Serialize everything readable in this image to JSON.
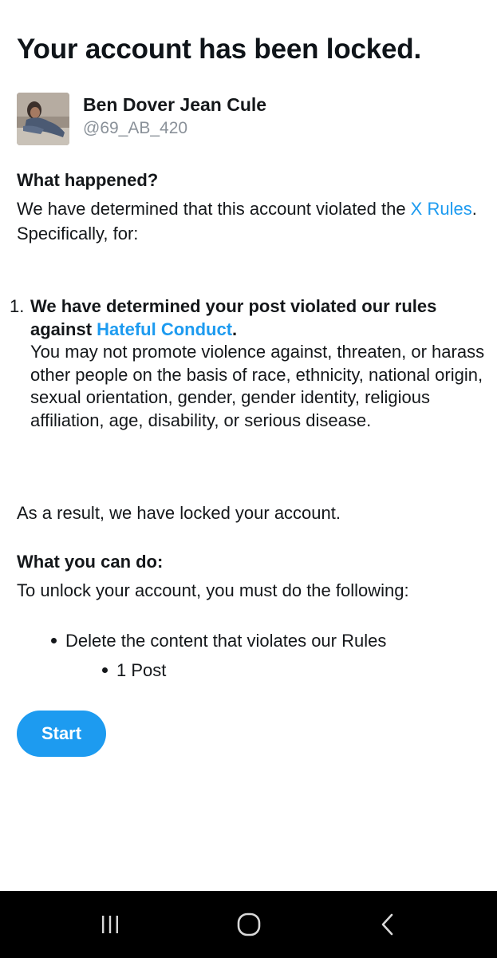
{
  "title": "Your account has been locked.",
  "account": {
    "name": "Ben Dover Jean Cule",
    "handle": "@69_AB_420"
  },
  "what_happened": {
    "heading": "What happened?",
    "text_before_link": "We have determined that this account violated the ",
    "link_text": "X Rules",
    "text_after_link": ". Specifically, for:"
  },
  "violation": {
    "number": "1.",
    "title_before_link": "We have determined your post violated our rules against ",
    "title_link": "Hateful Conduct",
    "title_after_link": ".",
    "description": "You may not promote violence against, threaten, or harass other people on the basis of race, ethnicity, national origin, sexual orientation, gender, gender identity, religious affiliation, age, disability, or serious disease."
  },
  "result_text": "As a result, we have locked your account.",
  "what_you_can_do": {
    "heading": "What you can do:",
    "text": "To unlock your account, you must do the following:",
    "steps": [
      {
        "label": "Delete the content that violates our Rules",
        "sub_items": [
          "1 Post"
        ]
      }
    ]
  },
  "start_label": "Start",
  "colors": {
    "link": "#1d9bf0",
    "button": "#1d9bf0",
    "text": "#14171a",
    "muted": "#8a9199",
    "navbar": "#000000"
  },
  "navbar": {
    "buttons": [
      {
        "icon": "recent-apps-icon"
      },
      {
        "icon": "home-icon"
      },
      {
        "icon": "back-icon"
      }
    ]
  }
}
